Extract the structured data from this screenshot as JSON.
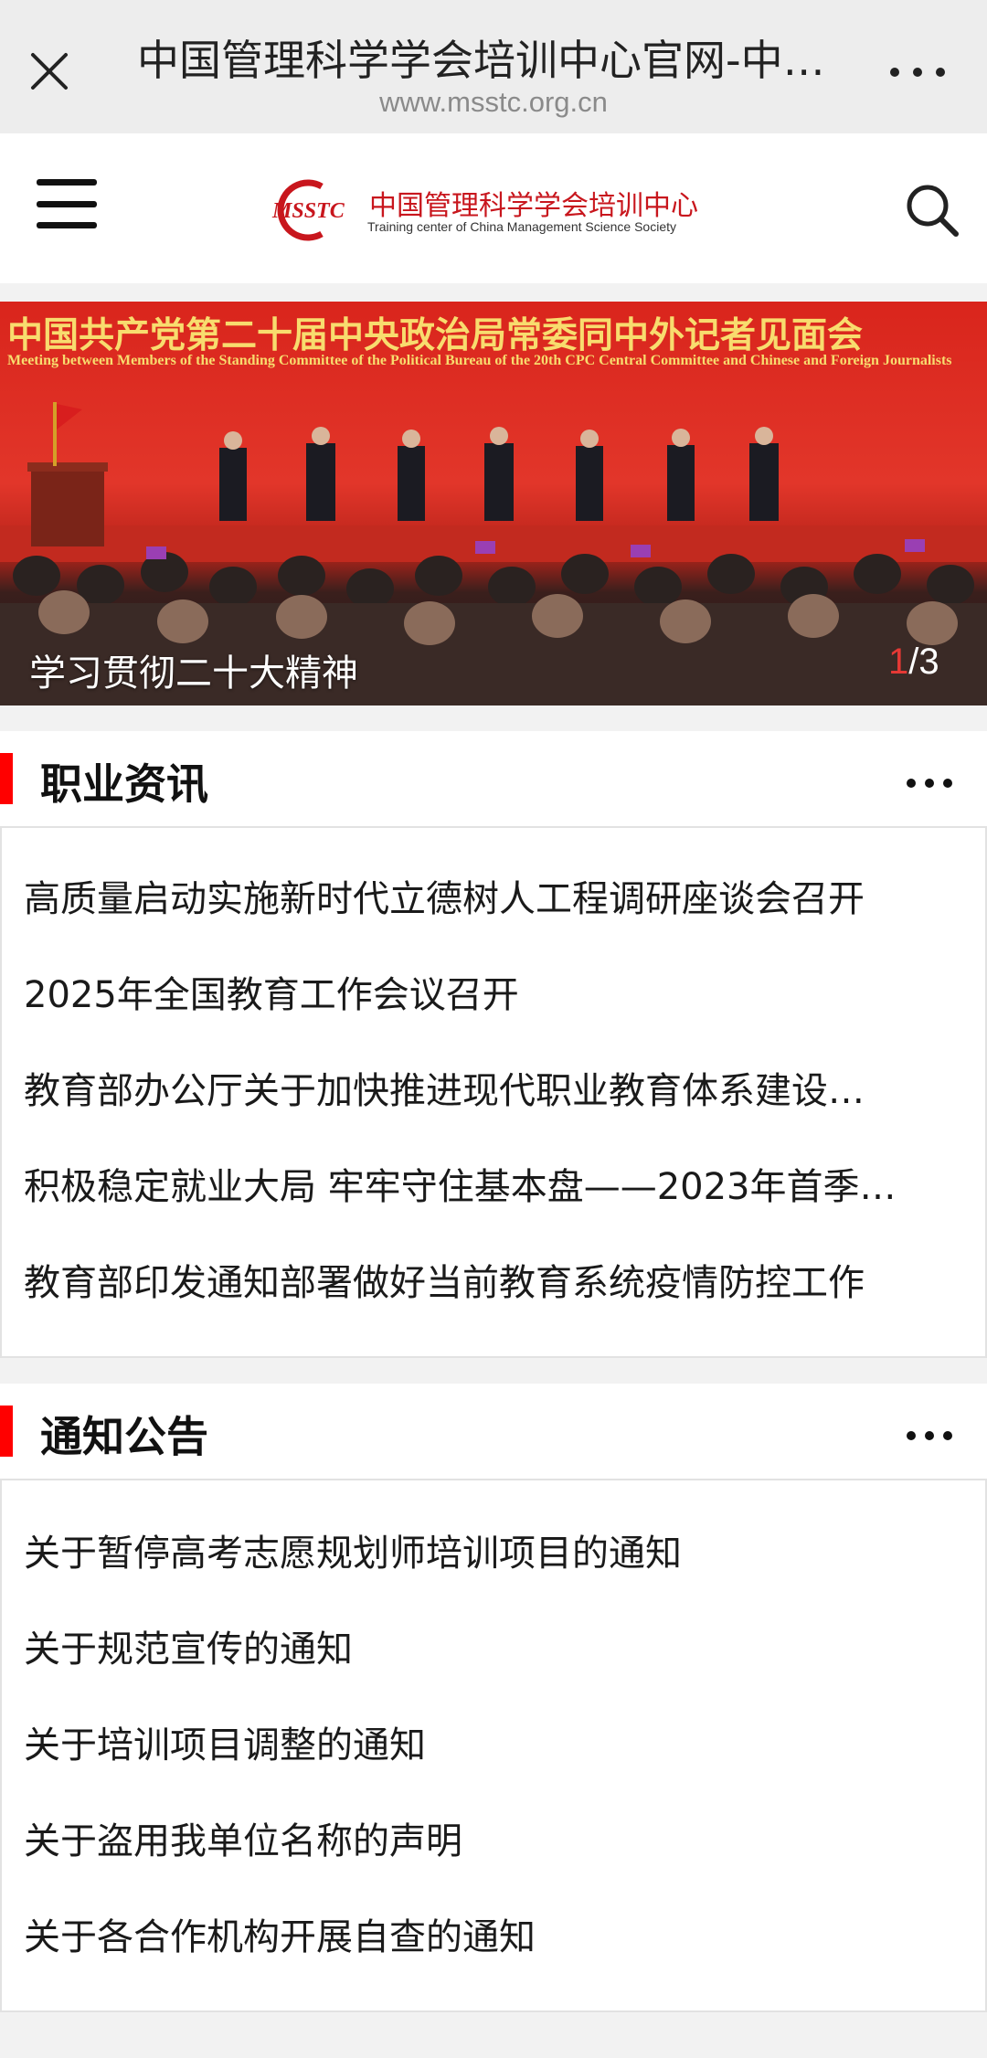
{
  "browser": {
    "title": "中国管理科学学会培训中心官网-中…",
    "url": "www.msstc.org.cn"
  },
  "header": {
    "logo_mark": "MSSTC",
    "logo_cn": "中国管理科学学会培训中心",
    "logo_en": "Training center of China Management Science Society"
  },
  "banner": {
    "headline": "中国共产党第二十届中央政治局常委同中外记者见面会",
    "subheadline": "Meeting between Members of the Standing Committee of the Political Bureau of the 20th CPC Central Committee and Chinese and Foreign Journalists",
    "caption": "学习贯彻二十大精神",
    "current": "1",
    "total": "/3"
  },
  "sections": {
    "news": {
      "title": "职业资讯",
      "items": [
        "高质量启动实施新时代立德树人工程调研座谈会召开",
        "2025年全国教育工作会议召开",
        "教育部办公厅关于加快推进现代职业教育体系建设…",
        "积极稳定就业大局 牢牢守住基本盘——2023年首季…",
        "教育部印发通知部署做好当前教育系统疫情防控工作"
      ]
    },
    "notices": {
      "title": "通知公告",
      "items": [
        "关于暂停高考志愿规划师培训项目的通知",
        "关于规范宣传的通知",
        "关于培训项目调整的通知",
        "关于盗用我单位名称的声明",
        "关于各合作机构开展自查的通知"
      ]
    }
  },
  "colors": {
    "accent": "#ff0000",
    "brand_red": "#c8161d"
  }
}
